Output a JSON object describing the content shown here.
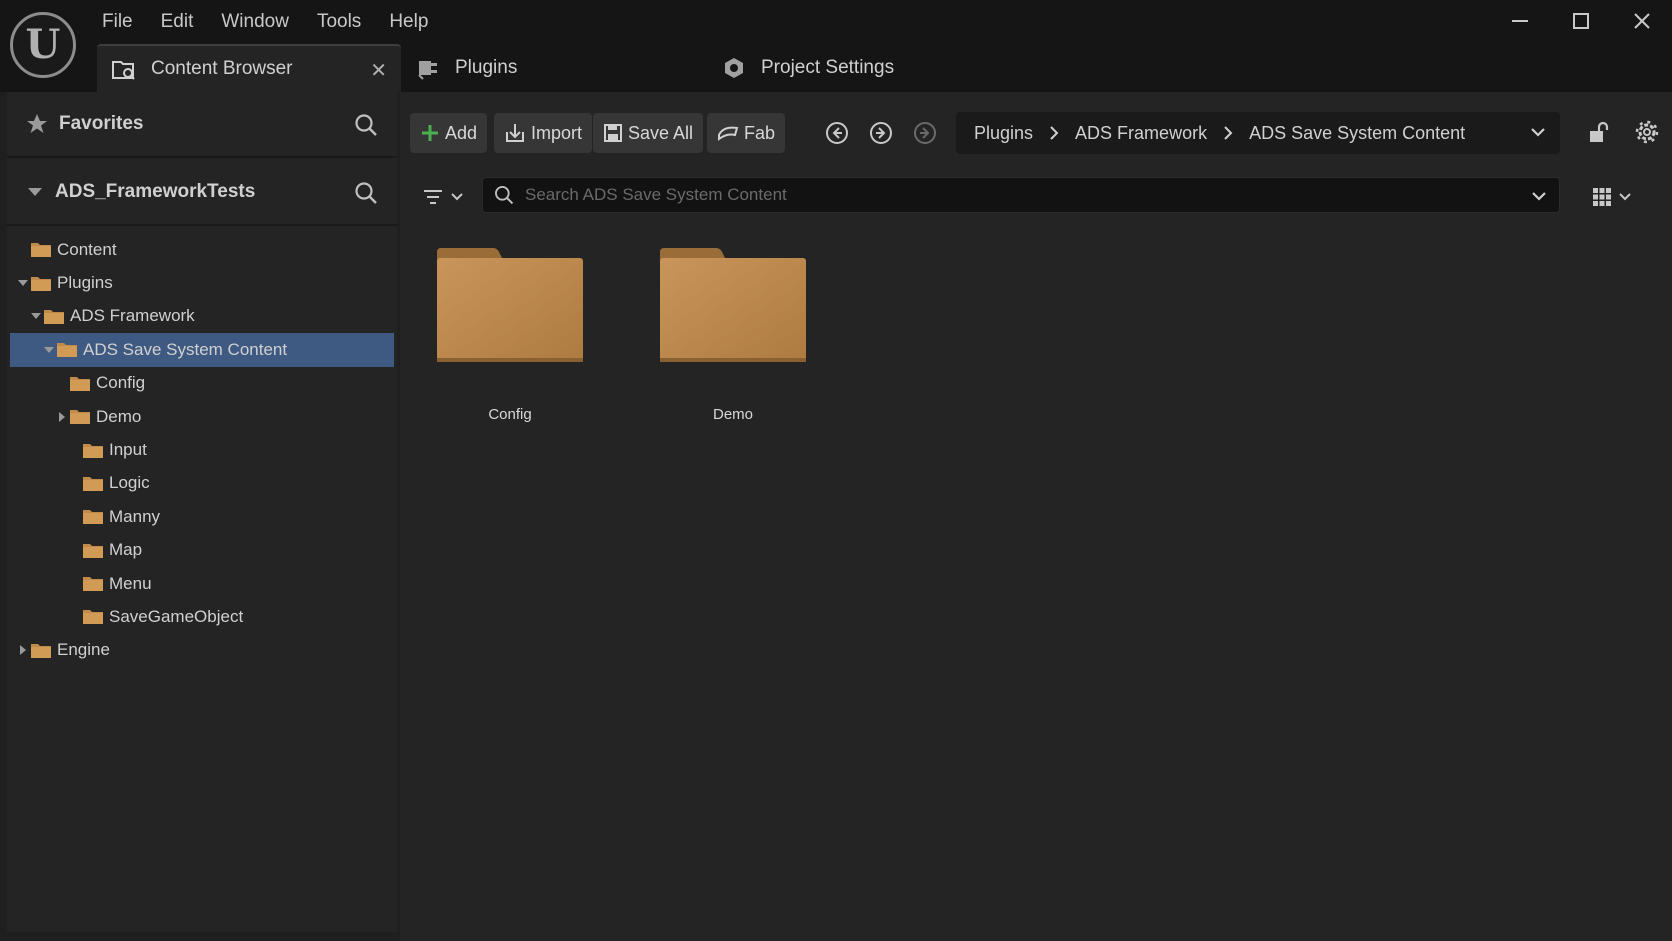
{
  "menu": [
    "File",
    "Edit",
    "Window",
    "Tools",
    "Help"
  ],
  "tabs": {
    "content_browser": "Content Browser",
    "plugins": "Plugins",
    "project_settings": "Project Settings"
  },
  "left_panel": {
    "favorites_label": "Favorites",
    "project_label": "ADS_FrameworkTests",
    "tree": [
      {
        "label": "Content",
        "level": 0,
        "arrow": "none"
      },
      {
        "label": "Plugins",
        "level": 0,
        "arrow": "down"
      },
      {
        "label": "ADS Framework",
        "level": 1,
        "arrow": "down"
      },
      {
        "label": "ADS Save System Content",
        "level": 2,
        "arrow": "down",
        "selected": true
      },
      {
        "label": "Config",
        "level": 3,
        "arrow": "none"
      },
      {
        "label": "Demo",
        "level": 3,
        "arrow": "right"
      },
      {
        "label": "Input",
        "level": 4,
        "arrow": "none"
      },
      {
        "label": "Logic",
        "level": 4,
        "arrow": "none"
      },
      {
        "label": "Manny",
        "level": 4,
        "arrow": "none"
      },
      {
        "label": "Map",
        "level": 4,
        "arrow": "none"
      },
      {
        "label": "Menu",
        "level": 4,
        "arrow": "none"
      },
      {
        "label": "SaveGameObject",
        "level": 4,
        "arrow": "none"
      },
      {
        "label": "Engine",
        "level": 0,
        "arrow": "right"
      }
    ]
  },
  "toolbar": {
    "add_label": "Add",
    "import_label": "Import",
    "save_all_label": "Save All",
    "fab_label": "Fab"
  },
  "breadcrumb": [
    "Plugins",
    "ADS Framework",
    "ADS Save System Content"
  ],
  "search": {
    "placeholder": "Search ADS Save System Content"
  },
  "folders": [
    "Config",
    "Demo"
  ],
  "colors": {
    "accent_selected": "#3f5a82",
    "folder": "#c08a4a",
    "add_green": "#4caf50"
  }
}
